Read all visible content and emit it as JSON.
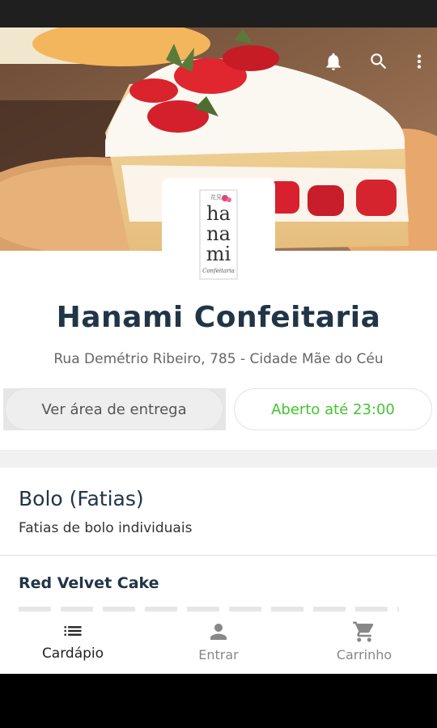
{
  "header": {
    "icons": [
      "bell-icon",
      "search-icon",
      "more-vert-icon"
    ]
  },
  "logo": {
    "brand_lines": [
      "ha",
      "na",
      "mi"
    ],
    "script": "Confeitaria"
  },
  "store": {
    "name": "Hanami Confeitaria",
    "address": "Rua Demétrio Ribeiro, 785 - Cidade Mãe do Céu",
    "delivery_area_label": "Ver área de entrega",
    "open_status": "Aberto até 23:00",
    "open_color": "#44c431"
  },
  "menu": {
    "category": {
      "title": "Bolo (Fatias)",
      "description": "Fatias de bolo individuais"
    },
    "items": [
      {
        "name": "Red Velvet Cake"
      }
    ]
  },
  "bottom_nav": {
    "items": [
      {
        "label": "Cardápio",
        "icon": "list-icon",
        "active": true
      },
      {
        "label": "Entrar",
        "icon": "person-icon",
        "active": false
      },
      {
        "label": "Carrinho",
        "icon": "cart-icon",
        "active": false
      }
    ]
  }
}
